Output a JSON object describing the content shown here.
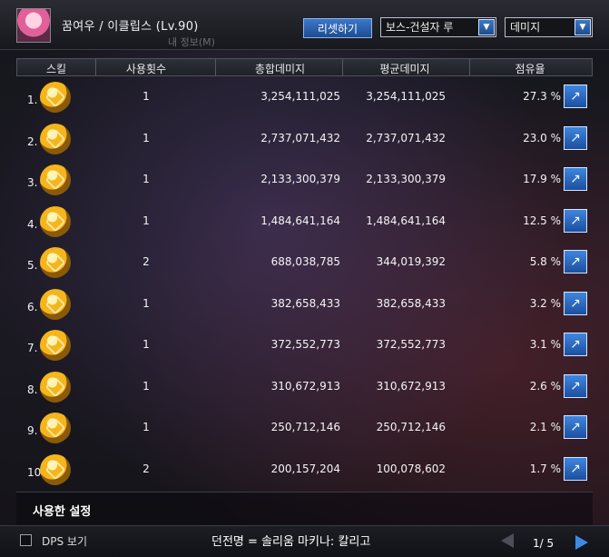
{
  "header": {
    "character_name": "꿈여우 / 이클립스 (Lv.90)",
    "reset_label": "리셋하기",
    "dungeon_select": {
      "value": "보스-건설자 루"
    },
    "metric_select": {
      "value": "데미지"
    },
    "ghost_title": "내 정보(M)"
  },
  "table": {
    "columns": [
      "스킬",
      "사용횟수",
      "총합데미지",
      "평균데미지",
      "점유율"
    ],
    "rows": [
      {
        "rank": "1.",
        "uses": "1",
        "total": "3,254,111,025",
        "avg": "3,254,111,025",
        "share": "27.3 %",
        "icon": "crown-skill-icon"
      },
      {
        "rank": "2.",
        "uses": "1",
        "total": "2,737,071,432",
        "avg": "2,737,071,432",
        "share": "23.0 %",
        "icon": "spiral-skill-icon"
      },
      {
        "rank": "3.",
        "uses": "1",
        "total": "2,133,300,379",
        "avg": "2,133,300,379",
        "share": "17.9 %",
        "icon": "ring-skill-icon"
      },
      {
        "rank": "4.",
        "uses": "1",
        "total": "1,484,641,164",
        "avg": "1,484,641,164",
        "share": "12.5 %",
        "icon": "star-burst-skill-icon"
      },
      {
        "rank": "5.",
        "uses": "2",
        "total": "688,038,785",
        "avg": "344,019,392",
        "share": "5.8 %",
        "icon": "fountain-skill-icon"
      },
      {
        "rank": "6.",
        "uses": "1",
        "total": "382,658,433",
        "avg": "382,658,433",
        "share": "3.2 %",
        "icon": "shield-skill-icon"
      },
      {
        "rank": "7.",
        "uses": "1",
        "total": "372,552,773",
        "avg": "372,552,773",
        "share": "3.1 %",
        "icon": "guard-skill-icon"
      },
      {
        "rank": "8.",
        "uses": "1",
        "total": "310,672,913",
        "avg": "310,672,913",
        "share": "2.6 %",
        "icon": "demon-skill-icon"
      },
      {
        "rank": "9.",
        "uses": "1",
        "total": "250,712,146",
        "avg": "250,712,146",
        "share": "2.1 %",
        "icon": "spark-skill-icon"
      },
      {
        "rank": "10.",
        "uses": "2",
        "total": "200,157,204",
        "avg": "100,078,602",
        "share": "1.7 %",
        "icon": "runner-skill-icon"
      }
    ],
    "detail_icon": "share-arrow-icon"
  },
  "footer": {
    "settings_label": "사용한 설정",
    "dps_label": "DPS 보기",
    "dungeon_name": "던전명 = 솔리움 마키나: 칼리고",
    "page": "1/ 5"
  },
  "colors": {
    "accent": "#3d78c9",
    "next": "#3c8be6"
  }
}
